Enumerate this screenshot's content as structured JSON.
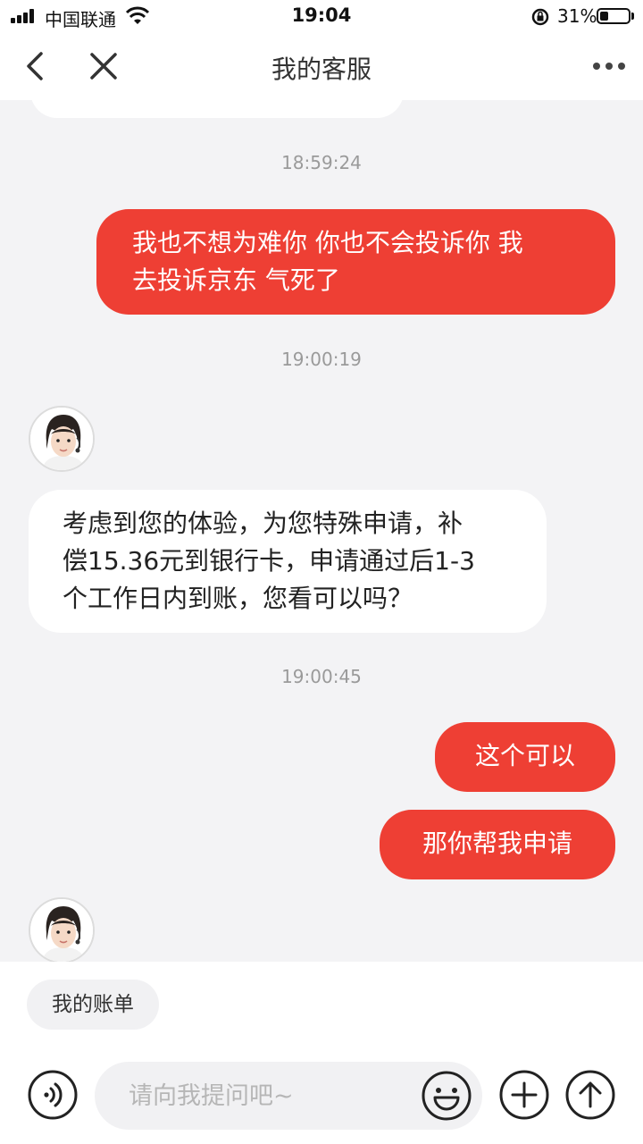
{
  "status_bar": {
    "carrier": "中国联通",
    "time": "19:04",
    "battery_percent": "31%",
    "battery_level": 0.31
  },
  "nav": {
    "title": "我的客服",
    "icons": [
      "chevron-left-icon",
      "close-icon",
      "more-icon"
    ]
  },
  "messages": [
    {
      "type": "timestamp",
      "text": "18:59:24"
    },
    {
      "type": "outgoing",
      "lines": [
        "我也不想为难你 你也不会投诉你 我",
        "去投诉京东 气死了"
      ]
    },
    {
      "type": "timestamp",
      "text": "19:00:19"
    },
    {
      "type": "incoming",
      "lines": [
        "考虑到您的体验，为您特殊申请，补",
        "偿15.36元到银行卡，申请通过后1-3",
        "个工作日内到账，您看可以吗？"
      ]
    },
    {
      "type": "timestamp",
      "text": "19:00:45"
    },
    {
      "type": "outgoing",
      "lines": [
        "这个可以"
      ]
    },
    {
      "type": "outgoing",
      "lines": [
        "那你帮我申请"
      ]
    }
  ],
  "quick_reply": {
    "label": "我的账单"
  },
  "composer": {
    "placeholder": "请向我提问吧~",
    "icons": [
      "voice-icon",
      "emoji-icon",
      "plus-icon",
      "send-icon"
    ]
  },
  "colors": {
    "accent": "#ee3f34",
    "background": "#f3f3f5",
    "timestamp": "#9a9a9a"
  }
}
